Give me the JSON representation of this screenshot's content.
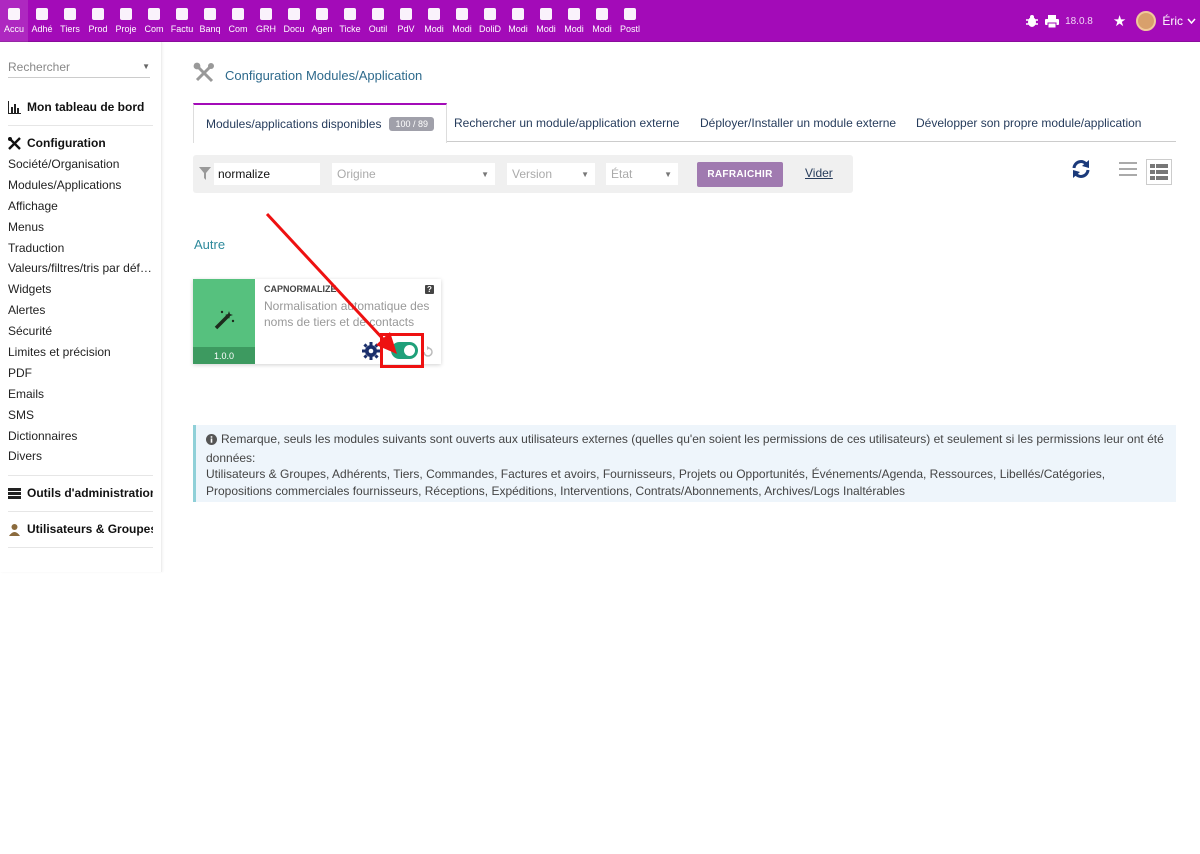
{
  "topmenu": [
    {
      "label": "Accu",
      "icon": "home-icon"
    },
    {
      "label": "Adhé",
      "icon": "members-icon"
    },
    {
      "label": "Tiers",
      "icon": "building-icon"
    },
    {
      "label": "Prod",
      "icon": "cube-icon"
    },
    {
      "label": "Proje",
      "icon": "project-icon"
    },
    {
      "label": "Com",
      "icon": "briefcase-icon"
    },
    {
      "label": "Factu",
      "icon": "invoice-icon"
    },
    {
      "label": "Banq",
      "icon": "bank-icon"
    },
    {
      "label": "Com",
      "icon": "search-icon"
    },
    {
      "label": "GRH",
      "icon": "users-icon"
    },
    {
      "label": "Docu",
      "icon": "folder-icon"
    },
    {
      "label": "Agen",
      "icon": "calendar-icon"
    },
    {
      "label": "Ticke",
      "icon": "ticket-icon"
    },
    {
      "label": "Outil",
      "icon": "wrench-icon"
    },
    {
      "label": "PdV",
      "icon": "pos-icon"
    },
    {
      "label": "Modi",
      "icon": "module-icon"
    },
    {
      "label": "Modi",
      "icon": "module-icon"
    },
    {
      "label": "DoliD",
      "icon": "module-icon"
    },
    {
      "label": "Modi",
      "icon": "module-icon"
    },
    {
      "label": "Modi",
      "icon": "module-icon"
    },
    {
      "label": "Modi",
      "icon": "module-icon"
    },
    {
      "label": "Modi",
      "icon": "module-icon"
    },
    {
      "label": "Postl",
      "icon": "envelope-icon"
    }
  ],
  "topright": {
    "version": "18.0.8",
    "username": "Éric"
  },
  "sidebar": {
    "search_placeholder": "Rechercher",
    "dashboard": "Mon tableau de bord",
    "configuration": "Configuration",
    "config_items": [
      "Société/Organisation",
      "Modules/Applications",
      "Affichage",
      "Menus",
      "Traduction",
      "Valeurs/filtres/tris par défaut",
      "Widgets",
      "Alertes",
      "Sécurité",
      "Limites et précision",
      "PDF",
      "Emails",
      "SMS",
      "Dictionnaires",
      "Divers"
    ],
    "admin_tools": "Outils d'administration",
    "users_groups": "Utilisateurs & Groupes"
  },
  "page": {
    "title": "Configuration Modules/Application"
  },
  "tabs": [
    {
      "label": "Modules/applications disponibles",
      "badge": "100 / 89"
    },
    {
      "label": "Rechercher un module/application externe"
    },
    {
      "label": "Déployer/Installer un module externe"
    },
    {
      "label": "Développer son propre module/application"
    }
  ],
  "filters": {
    "search_value": "normalize",
    "origin_placeholder": "Origine",
    "version_placeholder": "Version",
    "state_placeholder": "État",
    "refresh_label": "RAFRAICHIR",
    "clear_label": "Vider"
  },
  "section_title": "Autre",
  "module_card": {
    "name": "CAPNORMALIZE",
    "help": "?",
    "description": "Normalisation automatique des noms de tiers et de contacts",
    "version": "1.0.0",
    "enabled": true
  },
  "notice": {
    "text": "Remarque, seuls les modules suivants sont ouverts aux utilisateurs externes (quelles qu'en soient les permissions de ces utilisateurs) et seulement si les permissions leur ont été données:",
    "modules": "Utilisateurs & Groupes, Adhérents, Tiers, Commandes, Factures et avoirs, Fournisseurs, Projets ou Opportunités, Événements/Agenda, Ressources, Libellés/Catégories, Propositions commerciales fournisseurs, Réceptions, Expéditions, Interventions, Contrats/Abonnements, Archives/Logs Inaltérables"
  },
  "colors": {
    "topbar": "#a30bb8",
    "card_green": "#56c17e",
    "toggle_on": "#1fa07a",
    "annotation_red": "#ee1111"
  }
}
